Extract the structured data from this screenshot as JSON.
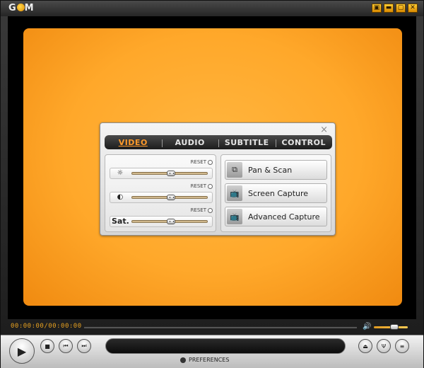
{
  "app": {
    "logo_text": "G",
    "logo_text2": "M"
  },
  "window_buttons": [
    "▣",
    "▬",
    "▢",
    "✕"
  ],
  "panel": {
    "close": "×",
    "tabs": [
      {
        "label": "VIDEO",
        "active": true
      },
      {
        "label": "AUDIO",
        "active": false
      },
      {
        "label": "SUBTITLE",
        "active": false
      },
      {
        "label": "CONTROL",
        "active": false
      }
    ],
    "sliders": [
      {
        "icon": "brightness-icon",
        "glyph": "☼",
        "reset_label": "RESET",
        "value": 0.52
      },
      {
        "icon": "contrast-icon",
        "glyph": "◐",
        "reset_label": "RESET",
        "value": 0.52
      },
      {
        "icon": "saturation-label",
        "glyph": "Sat.",
        "reset_label": "RESET",
        "value": 0.52
      }
    ],
    "buttons": [
      {
        "label": "Pan & Scan",
        "icon": "pan-scan-icon",
        "glyph": "⧉"
      },
      {
        "label": "Screen Capture",
        "icon": "tv-capture-icon",
        "glyph": "📺"
      },
      {
        "label": "Advanced Capture",
        "icon": "tv-advanced-capture-icon",
        "glyph": "📺"
      }
    ]
  },
  "seek": {
    "time": "00:00:00/00:00:00",
    "volume": 0.6
  },
  "controls": {
    "play": "▶",
    "stop": "■",
    "prev": "⏮",
    "next": "⏭",
    "eject": "⏏",
    "equalizer": "Ψ",
    "menu": "≡",
    "preferences_label": "PREFERENCES"
  },
  "colors": {
    "accent": "#ff9a2a",
    "video_bg": "#ffa82a"
  }
}
